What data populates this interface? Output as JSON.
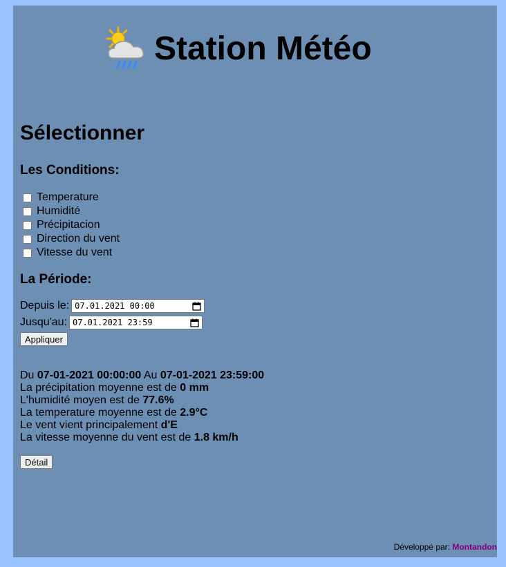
{
  "header": {
    "title": "Station Météo",
    "logo_icon": "sun-cloud-rain-icon"
  },
  "selection": {
    "heading": "Sélectionner",
    "conditions_heading": "Les Conditions:",
    "conditions": [
      {
        "label": "Temperature",
        "checked": false
      },
      {
        "label": "Humidité",
        "checked": false
      },
      {
        "label": "Précipitacion",
        "checked": false
      },
      {
        "label": "Direction du vent",
        "checked": false
      },
      {
        "label": "Vitesse du vent",
        "checked": false
      }
    ],
    "period_heading": "La Période:",
    "from_label": "Depuis le:",
    "from_value": "07.01.2021 00:00",
    "to_label": "Jusqu'au:",
    "to_value": "07.01.2021 23:59",
    "apply_label": "Appliquer"
  },
  "results": {
    "range_prefix": "Du ",
    "range_from": "07-01-2021 00:00:00",
    "range_mid": " Au ",
    "range_to": "07-01-2021 23:59:00",
    "precip_text": "La précipitation moyenne est de ",
    "precip_value": "0 mm",
    "humidity_text": "L'humidité moyen est de ",
    "humidity_value": "77.6%",
    "temp_text": "La temperature moyenne est de ",
    "temp_value": "2.9°C",
    "wind_dir_text": "Le vent vient principalement ",
    "wind_dir_value": "d'E",
    "wind_speed_text": "La vitesse moyenne du vent est de ",
    "wind_speed_value": "1.8 km/h",
    "detail_label": "Détail"
  },
  "footer": {
    "text": "Développé par: ",
    "author": "Montandon",
    "author_color": "#800080"
  },
  "colors": {
    "page_bg": "#99c4ff",
    "panel_bg": "#6d8fb4"
  }
}
